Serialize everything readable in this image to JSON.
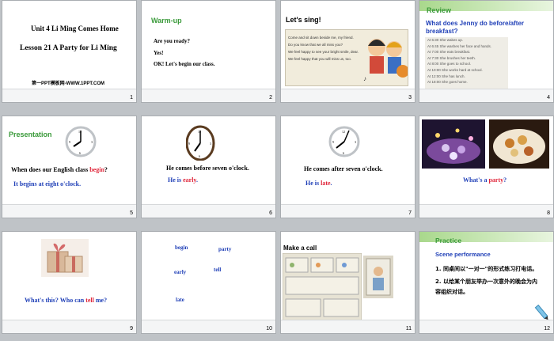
{
  "slides": [
    {
      "n": "1",
      "unit": "Unit 4  Li Ming Comes Home",
      "lesson": "Lesson 21  A Party for Li Ming",
      "site": "第一PPT模板网-WWW.1PPT.COM"
    },
    {
      "n": "2",
      "title": "Warm-up",
      "l1": "Are you ready?",
      "l2": "Yes!",
      "l3": "OK! Let's begin our class."
    },
    {
      "n": "3",
      "title": "Let's sing!",
      "song": [
        "Come and sit down beside me, my friend.",
        "Do you know that we all miss you?",
        "We feel happy to see your bright smile, dear.",
        "We feel happy that you will miss us, too."
      ]
    },
    {
      "n": "4",
      "banner": "Review",
      "q": "What  does Jenny do before/after breakfast?",
      "sched": [
        "At 6:30  She wakes up.",
        "At 6:45  She washes her face and hands.",
        "At 7:00  She eats breakfast.",
        "At 7:30  She brushes her teeth.",
        "At 8:00  She goes to school.",
        "At 10:00  She works hard at school.",
        "At 12:00  She has lunch.",
        "At 18:00  She goes home."
      ]
    },
    {
      "n": "5",
      "banner": "Presentation",
      "q_pre": "When does our English class ",
      "q_red": "begin",
      "q_post": "?",
      "a": "It begins at eight o'clock."
    },
    {
      "n": "6",
      "l1": "He comes before seven o'clock.",
      "l2_pre": "He is ",
      "l2_red": "early",
      "l2_post": "."
    },
    {
      "n": "7",
      "l1": "He comes after seven o'clock.",
      "l2_pre": "He is ",
      "l2_red": "late",
      "l2_post": "."
    },
    {
      "n": "8",
      "q_pre": "What's a ",
      "q_red": "party",
      "q_post": "?"
    },
    {
      "n": "9",
      "q_pre": "What's this? Who can ",
      "q_red": "tell",
      "q_post": " me?"
    },
    {
      "n": "10",
      "w1": "begin",
      "w2": "party",
      "w3": "early",
      "w4": "tell",
      "w5": "late"
    },
    {
      "n": "11",
      "title": "Make a call"
    },
    {
      "n": "12",
      "banner": "Practice",
      "sub": "Scene performance",
      "p1": "1. 同桌间以\"一对一\"的形式练习打电话。",
      "p2": "2. 以给某个朋友举办一次意外的晚会为内容组织对话。"
    }
  ]
}
